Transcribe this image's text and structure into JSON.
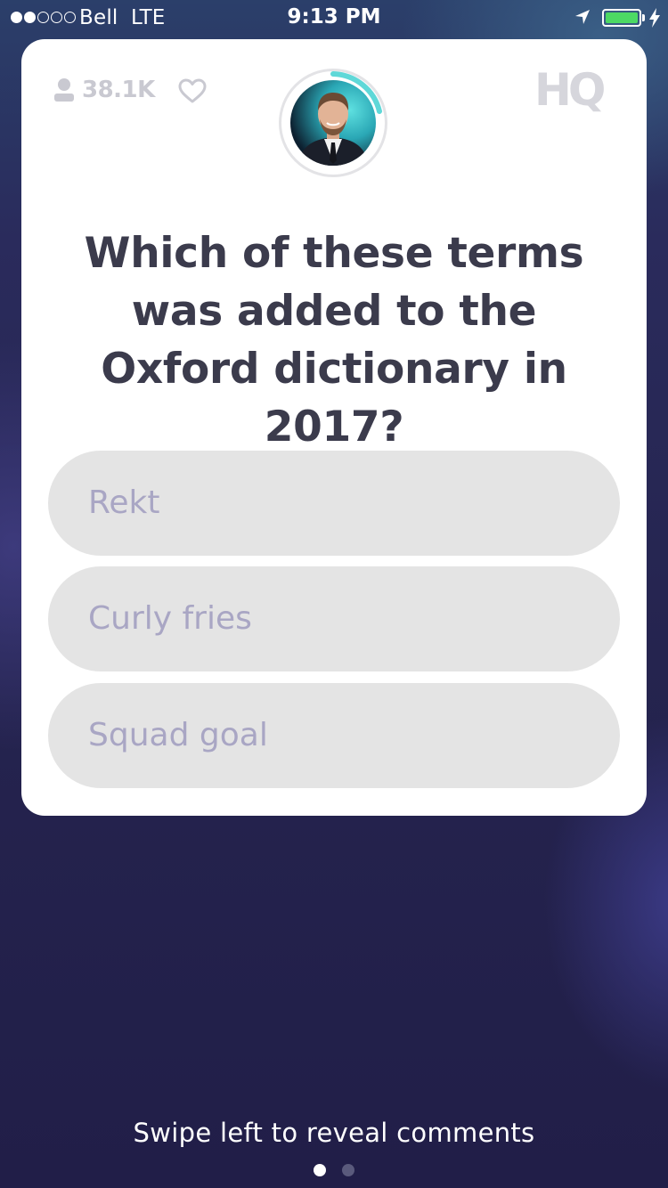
{
  "status_bar": {
    "carrier": "Bell",
    "network": "LTE",
    "time": "9:13 PM",
    "signal_bars": 2,
    "signal_total": 5,
    "battery_color": "#4cd964"
  },
  "card": {
    "viewer_count": "38.1K",
    "logo": "HQ",
    "host_icon": "host-avatar",
    "question": "Which of these terms was added to the Oxford dictionary in 2017?",
    "answers": [
      {
        "label": "Rekt"
      },
      {
        "label": "Curly fries"
      },
      {
        "label": "Squad goal"
      }
    ]
  },
  "footer": {
    "swipe_hint": "Swipe left to reveal comments",
    "pages": 2,
    "active_page": 1
  },
  "colors": {
    "card_bg": "#ffffff",
    "answer_bg": "#e4e4e4",
    "answer_text": "#a9a6c4",
    "question_text": "#3b3b4c",
    "timer_accent": "#5fd8d8"
  }
}
